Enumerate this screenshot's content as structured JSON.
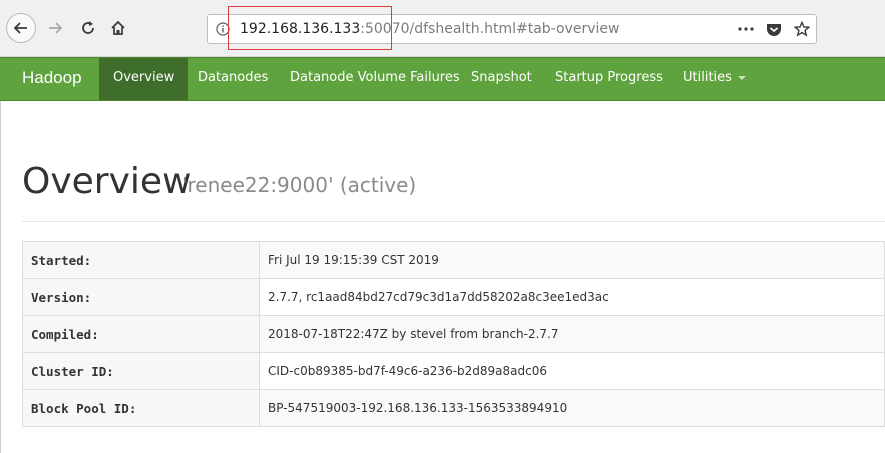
{
  "browser": {
    "url_host": "192.168.136.133",
    "url_rest": ":50070/dfshealth.html#tab-overview",
    "icons": [
      "back-arrow-icon",
      "forward-arrow-icon",
      "reload-icon",
      "home-icon",
      "info-icon",
      "more-icon",
      "pocket-icon",
      "bookmark-star-icon"
    ]
  },
  "navbar": {
    "brand": "Hadoop",
    "items": [
      {
        "label": "Overview",
        "active": true
      },
      {
        "label": "Datanodes"
      },
      {
        "label": "Datanode Volume Failures"
      },
      {
        "label": "Snapshot"
      },
      {
        "label": "Startup Progress"
      },
      {
        "label": "Utilities"
      }
    ],
    "color": "#5fa33e",
    "active_color": "#3f6d2b"
  },
  "page": {
    "title": "Overview",
    "subtitle": "'renee22:9000' (active)"
  },
  "info": {
    "rows": [
      {
        "key": "Started:",
        "value": "Fri Jul 19 19:15:39 CST 2019"
      },
      {
        "key": "Version:",
        "value": "2.7.7, rc1aad84bd27cd79c3d1a7dd58202a8c3ee1ed3ac"
      },
      {
        "key": "Compiled:",
        "value": "2018-07-18T22:47Z by stevel from branch-2.7.7"
      },
      {
        "key": "Cluster ID:",
        "value": "CID-c0b89385-bd7f-49c6-a236-b2d89a8adc06"
      },
      {
        "key": "Block Pool ID:",
        "value": "BP-547519003-192.168.136.133-1563533894910"
      }
    ]
  }
}
